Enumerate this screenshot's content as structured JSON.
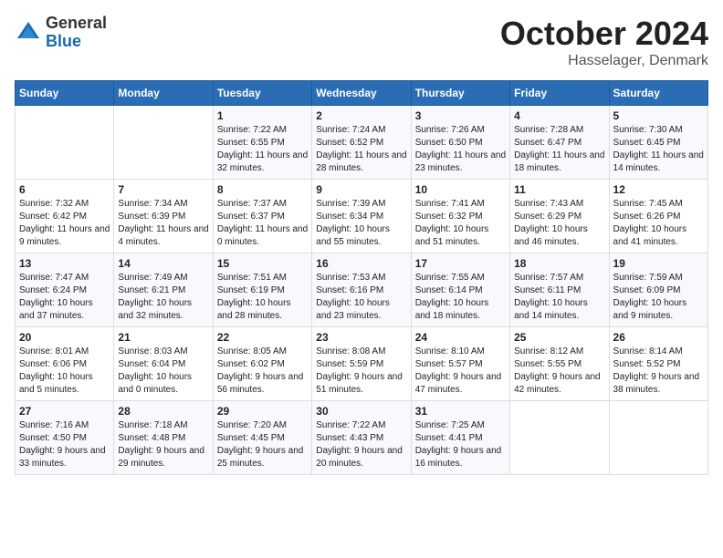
{
  "header": {
    "logo_general": "General",
    "logo_blue": "Blue",
    "month_title": "October 2024",
    "location": "Hasselager, Denmark"
  },
  "days_of_week": [
    "Sunday",
    "Monday",
    "Tuesday",
    "Wednesday",
    "Thursday",
    "Friday",
    "Saturday"
  ],
  "weeks": [
    [
      {
        "day": "",
        "info": ""
      },
      {
        "day": "",
        "info": ""
      },
      {
        "day": "1",
        "sunrise": "7:22 AM",
        "sunset": "6:55 PM",
        "daylight": "11 hours and 32 minutes."
      },
      {
        "day": "2",
        "sunrise": "7:24 AM",
        "sunset": "6:52 PM",
        "daylight": "11 hours and 28 minutes."
      },
      {
        "day": "3",
        "sunrise": "7:26 AM",
        "sunset": "6:50 PM",
        "daylight": "11 hours and 23 minutes."
      },
      {
        "day": "4",
        "sunrise": "7:28 AM",
        "sunset": "6:47 PM",
        "daylight": "11 hours and 18 minutes."
      },
      {
        "day": "5",
        "sunrise": "7:30 AM",
        "sunset": "6:45 PM",
        "daylight": "11 hours and 14 minutes."
      }
    ],
    [
      {
        "day": "6",
        "sunrise": "7:32 AM",
        "sunset": "6:42 PM",
        "daylight": "11 hours and 9 minutes."
      },
      {
        "day": "7",
        "sunrise": "7:34 AM",
        "sunset": "6:39 PM",
        "daylight": "11 hours and 4 minutes."
      },
      {
        "day": "8",
        "sunrise": "7:37 AM",
        "sunset": "6:37 PM",
        "daylight": "11 hours and 0 minutes."
      },
      {
        "day": "9",
        "sunrise": "7:39 AM",
        "sunset": "6:34 PM",
        "daylight": "10 hours and 55 minutes."
      },
      {
        "day": "10",
        "sunrise": "7:41 AM",
        "sunset": "6:32 PM",
        "daylight": "10 hours and 51 minutes."
      },
      {
        "day": "11",
        "sunrise": "7:43 AM",
        "sunset": "6:29 PM",
        "daylight": "10 hours and 46 minutes."
      },
      {
        "day": "12",
        "sunrise": "7:45 AM",
        "sunset": "6:26 PM",
        "daylight": "10 hours and 41 minutes."
      }
    ],
    [
      {
        "day": "13",
        "sunrise": "7:47 AM",
        "sunset": "6:24 PM",
        "daylight": "10 hours and 37 minutes."
      },
      {
        "day": "14",
        "sunrise": "7:49 AM",
        "sunset": "6:21 PM",
        "daylight": "10 hours and 32 minutes."
      },
      {
        "day": "15",
        "sunrise": "7:51 AM",
        "sunset": "6:19 PM",
        "daylight": "10 hours and 28 minutes."
      },
      {
        "day": "16",
        "sunrise": "7:53 AM",
        "sunset": "6:16 PM",
        "daylight": "10 hours and 23 minutes."
      },
      {
        "day": "17",
        "sunrise": "7:55 AM",
        "sunset": "6:14 PM",
        "daylight": "10 hours and 18 minutes."
      },
      {
        "day": "18",
        "sunrise": "7:57 AM",
        "sunset": "6:11 PM",
        "daylight": "10 hours and 14 minutes."
      },
      {
        "day": "19",
        "sunrise": "7:59 AM",
        "sunset": "6:09 PM",
        "daylight": "10 hours and 9 minutes."
      }
    ],
    [
      {
        "day": "20",
        "sunrise": "8:01 AM",
        "sunset": "6:06 PM",
        "daylight": "10 hours and 5 minutes."
      },
      {
        "day": "21",
        "sunrise": "8:03 AM",
        "sunset": "6:04 PM",
        "daylight": "10 hours and 0 minutes."
      },
      {
        "day": "22",
        "sunrise": "8:05 AM",
        "sunset": "6:02 PM",
        "daylight": "9 hours and 56 minutes."
      },
      {
        "day": "23",
        "sunrise": "8:08 AM",
        "sunset": "5:59 PM",
        "daylight": "9 hours and 51 minutes."
      },
      {
        "day": "24",
        "sunrise": "8:10 AM",
        "sunset": "5:57 PM",
        "daylight": "9 hours and 47 minutes."
      },
      {
        "day": "25",
        "sunrise": "8:12 AM",
        "sunset": "5:55 PM",
        "daylight": "9 hours and 42 minutes."
      },
      {
        "day": "26",
        "sunrise": "8:14 AM",
        "sunset": "5:52 PM",
        "daylight": "9 hours and 38 minutes."
      }
    ],
    [
      {
        "day": "27",
        "sunrise": "7:16 AM",
        "sunset": "4:50 PM",
        "daylight": "9 hours and 33 minutes."
      },
      {
        "day": "28",
        "sunrise": "7:18 AM",
        "sunset": "4:48 PM",
        "daylight": "9 hours and 29 minutes."
      },
      {
        "day": "29",
        "sunrise": "7:20 AM",
        "sunset": "4:45 PM",
        "daylight": "9 hours and 25 minutes."
      },
      {
        "day": "30",
        "sunrise": "7:22 AM",
        "sunset": "4:43 PM",
        "daylight": "9 hours and 20 minutes."
      },
      {
        "day": "31",
        "sunrise": "7:25 AM",
        "sunset": "4:41 PM",
        "daylight": "9 hours and 16 minutes."
      },
      {
        "day": "",
        "info": ""
      },
      {
        "day": "",
        "info": ""
      }
    ]
  ],
  "labels": {
    "sunrise": "Sunrise:",
    "sunset": "Sunset:",
    "daylight": "Daylight:"
  }
}
